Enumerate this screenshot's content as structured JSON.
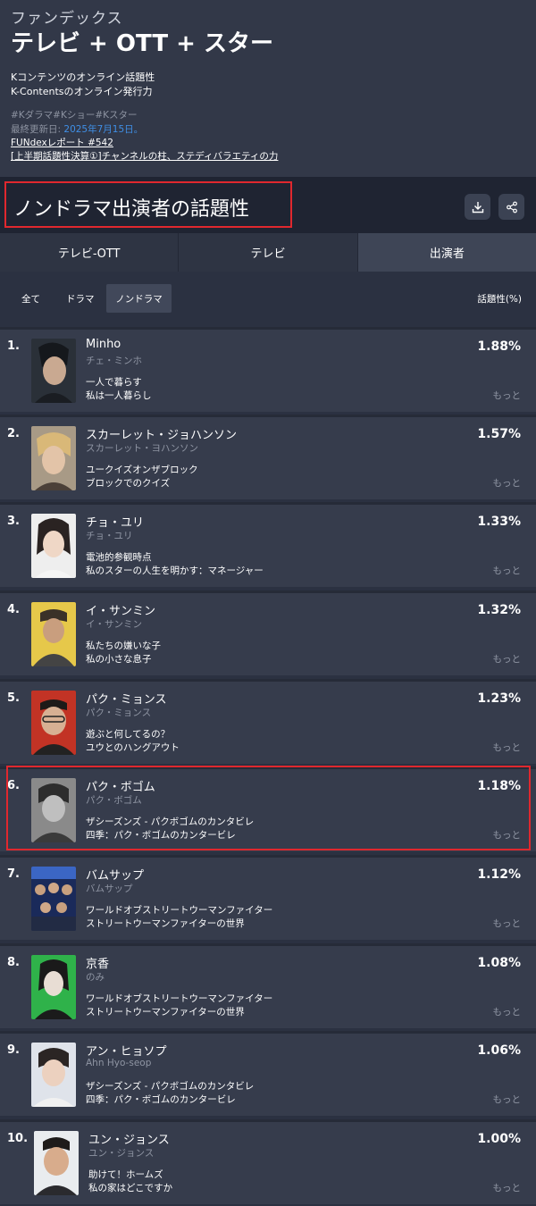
{
  "header": {
    "brand": "ファンデックス",
    "title": "テレビ + OTT + スター",
    "desc1": "Kコンテンツのオンライン話題性",
    "desc2": "K-Contentsのオンライン発行力",
    "tags": "#Kダラマ#Kショー#Kスター",
    "updated_label": "最終更新日:",
    "updated_date": "2025年7月15日。",
    "report": "FUNdexレポート #542",
    "report_sub": "[上半期話題性決算①]チャンネルの柱、ステディバラエティの力"
  },
  "section": {
    "title": "ノンドラマ出演者の話題性",
    "download_icon": "download-icon",
    "share_icon": "share-icon"
  },
  "tabs": [
    {
      "label": "テレビ-OTT",
      "active": false
    },
    {
      "label": "テレビ",
      "active": false
    },
    {
      "label": "出演者",
      "active": true
    }
  ],
  "filters": {
    "all": "全て",
    "drama": "ドラマ",
    "nondrama": "ノンドラマ",
    "column_header": "話題性(%)"
  },
  "colors": {
    "accent_red": "#e0282e",
    "link_blue": "#3f8fe6",
    "bg": "#2b3141",
    "row_bg": "#363c4c"
  },
  "rows": [
    {
      "rank": "1.",
      "name": "Minho",
      "sub": "チェ・ミンホ",
      "show1": "一人で暮らす",
      "show2": "私は一人暮らし",
      "pct": "1.88%",
      "more": "もっと"
    },
    {
      "rank": "2.",
      "name": "スカーレット・ジョハンソン",
      "sub": "スカーレット・ヨハンソン",
      "show1": "ユークイズオンザブロック",
      "show2": "ブロックでのクイズ",
      "pct": "1.57%",
      "more": "もっと"
    },
    {
      "rank": "3.",
      "name": "チョ・ユリ",
      "sub": "チョ・ユリ",
      "show1": "電池的参観時点",
      "show2": "私のスターの人生を明かす：マネージャー",
      "pct": "1.33%",
      "more": "もっと"
    },
    {
      "rank": "4.",
      "name": "イ・サンミン",
      "sub": "イ・サンミン",
      "show1": "私たちの嫌いな子",
      "show2": "私の小さな息子",
      "pct": "1.32%",
      "more": "もっと"
    },
    {
      "rank": "5.",
      "name": "パク・ミョンス",
      "sub": "パク・ミョンス",
      "show1": "遊ぶと何してるの？",
      "show2": "ユウとのハングアウト",
      "pct": "1.23%",
      "more": "もっと"
    },
    {
      "rank": "6.",
      "name": "パク・ボゴム",
      "sub": "パク・ボゴム",
      "show1": "ザシーズンズ - パクボゴムのカンタビレ",
      "show2": "四季：パク・ボゴムのカンタービレ",
      "pct": "1.18%",
      "more": "もっと"
    },
    {
      "rank": "7.",
      "name": "バムサップ",
      "sub": "バムサップ",
      "show1": "ワールドオブストリートウーマンファイター",
      "show2": "ストリートウーマンファイターの世界",
      "pct": "1.12%",
      "more": "もっと"
    },
    {
      "rank": "8.",
      "name": "京香",
      "sub": "のみ",
      "show1": "ワールドオブストリートウーマンファイター",
      "show2": "ストリートウーマンファイターの世界",
      "pct": "1.08%",
      "more": "もっと"
    },
    {
      "rank": "9.",
      "name": "アン・ヒョソプ",
      "sub": "Ahn Hyo-seop",
      "show1": "ザシーズンズ - パクボゴムのカンタビレ",
      "show2": "四季：パク・ボゴムのカンタービレ",
      "pct": "1.06%",
      "more": "もっと"
    },
    {
      "rank": "10.",
      "name": "ユン・ジョンス",
      "sub": "ユン・ジョンス",
      "show1": "助けて！ホームズ",
      "show2": "私の家はどこですか",
      "pct": "1.00%",
      "more": "もっと"
    }
  ]
}
